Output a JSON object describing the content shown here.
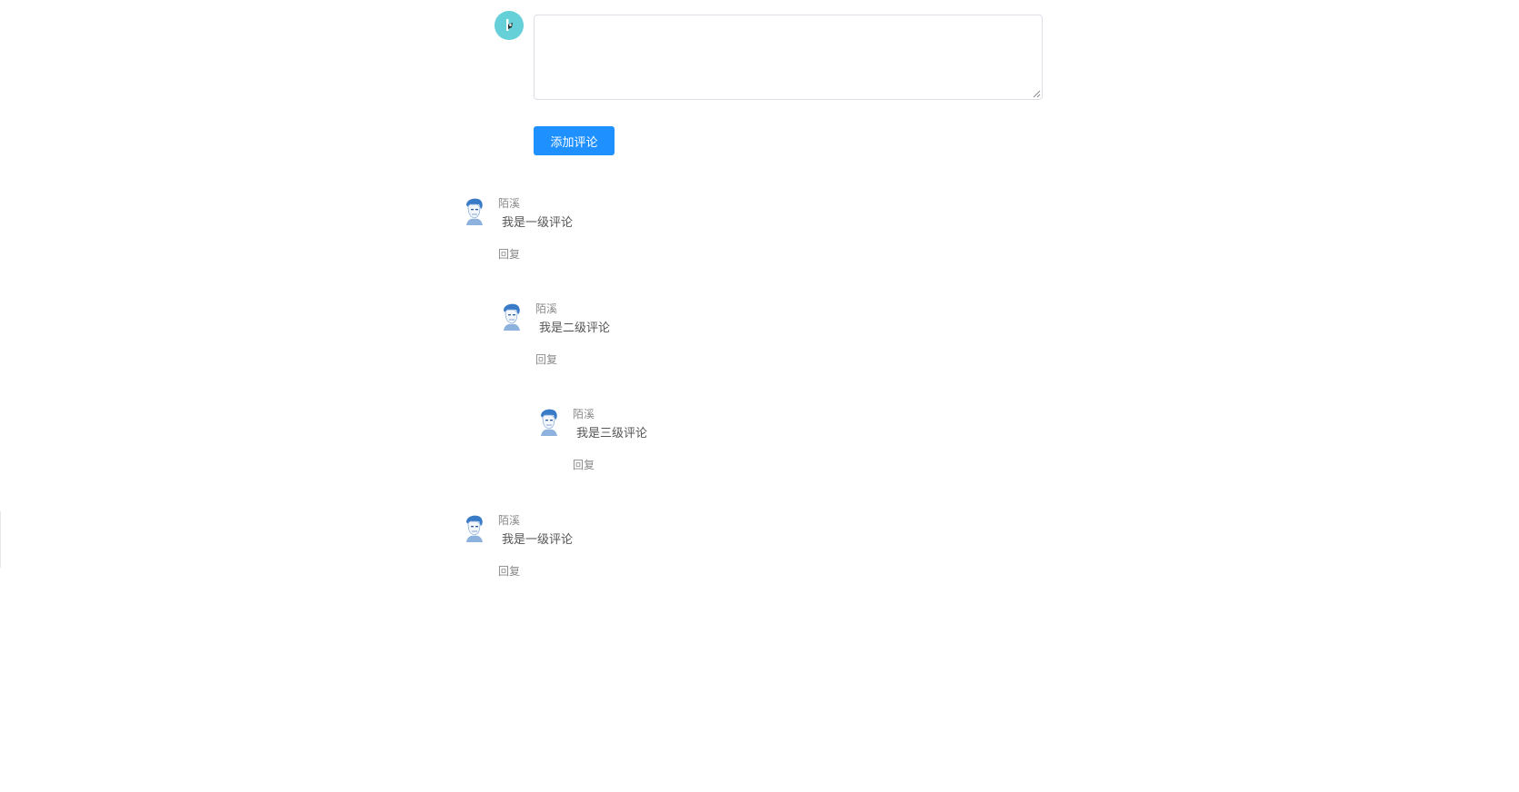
{
  "editor": {
    "input_value": "",
    "add_button_label": "添加评论"
  },
  "comments": [
    {
      "author": "陌溪",
      "content": "我是一级评论",
      "reply_label": "回复",
      "replies": [
        {
          "author": "陌溪",
          "content": "我是二级评论",
          "reply_label": "回复",
          "replies": [
            {
              "author": "陌溪",
              "content": "我是三级评论",
              "reply_label": "回复"
            }
          ]
        }
      ]
    },
    {
      "author": "陌溪",
      "content": "我是一级评论",
      "reply_label": "回复"
    }
  ],
  "colors": {
    "accent": "#1e90ff",
    "current_avatar_bg": "#66d0d8",
    "author_avatar": "#3a7bc8"
  },
  "icons": {
    "current_user": "user-avatar-icon",
    "comment_author": "author-avatar-icon"
  }
}
